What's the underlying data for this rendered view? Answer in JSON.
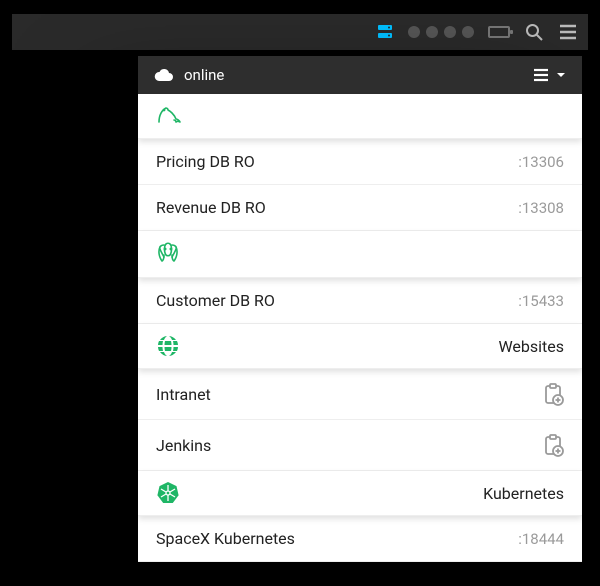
{
  "header": {
    "status": "online"
  },
  "sections": [
    {
      "id": "mysql",
      "label": "",
      "items": [
        {
          "label": "Pricing DB RO",
          "port": ":13306"
        },
        {
          "label": "Revenue DB RO",
          "port": ":13308"
        }
      ]
    },
    {
      "id": "postgres",
      "label": "",
      "items": [
        {
          "label": "Customer DB RO",
          "port": ":15433"
        }
      ]
    },
    {
      "id": "websites",
      "label": "Websites",
      "items": [
        {
          "label": "Intranet"
        },
        {
          "label": "Jenkins"
        }
      ]
    },
    {
      "id": "kubernetes",
      "label": "Kubernetes",
      "items": [
        {
          "label": "SpaceX Kubernetes",
          "port": ":18444"
        }
      ]
    }
  ]
}
